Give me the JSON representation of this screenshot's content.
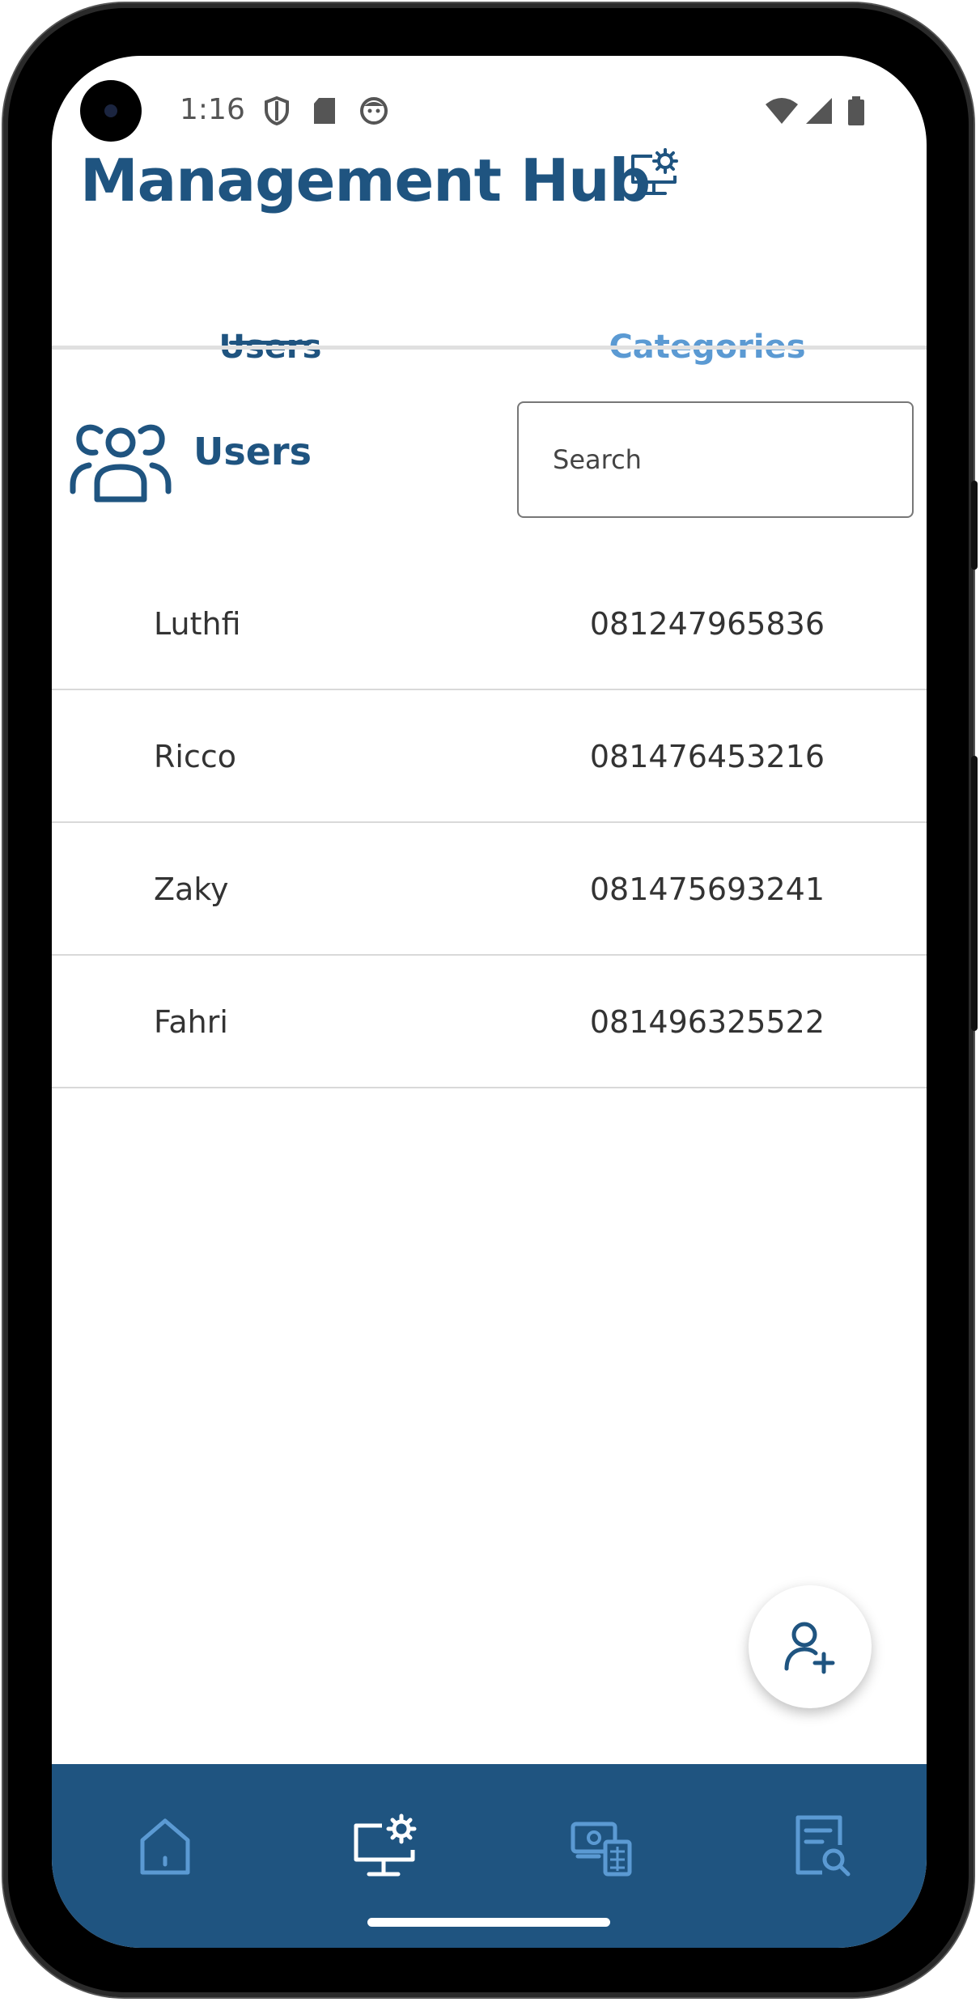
{
  "status_bar": {
    "time": "1:16"
  },
  "header": {
    "title": "Management Hub"
  },
  "tabs": [
    {
      "label": "Users",
      "active": true
    },
    {
      "label": "Categories",
      "active": false
    }
  ],
  "section": {
    "title": "Users"
  },
  "search": {
    "placeholder": "Search",
    "value": ""
  },
  "users": [
    {
      "name": "Luthfi",
      "phone": "081247965836"
    },
    {
      "name": "Ricco",
      "phone": "081476453216"
    },
    {
      "name": "Zaky",
      "phone": "081475693241"
    },
    {
      "name": "Fahri",
      "phone": "081496325522"
    }
  ],
  "fab": {
    "icon": "add-user-icon"
  },
  "bottom_nav": [
    {
      "icon": "home-icon",
      "active": false
    },
    {
      "icon": "management-icon",
      "active": true
    },
    {
      "icon": "transactions-icon",
      "active": false
    },
    {
      "icon": "reports-icon",
      "active": false
    }
  ],
  "colors": {
    "primary": "#1f5480",
    "accent": "#5b9ad3",
    "text": "#333333"
  }
}
